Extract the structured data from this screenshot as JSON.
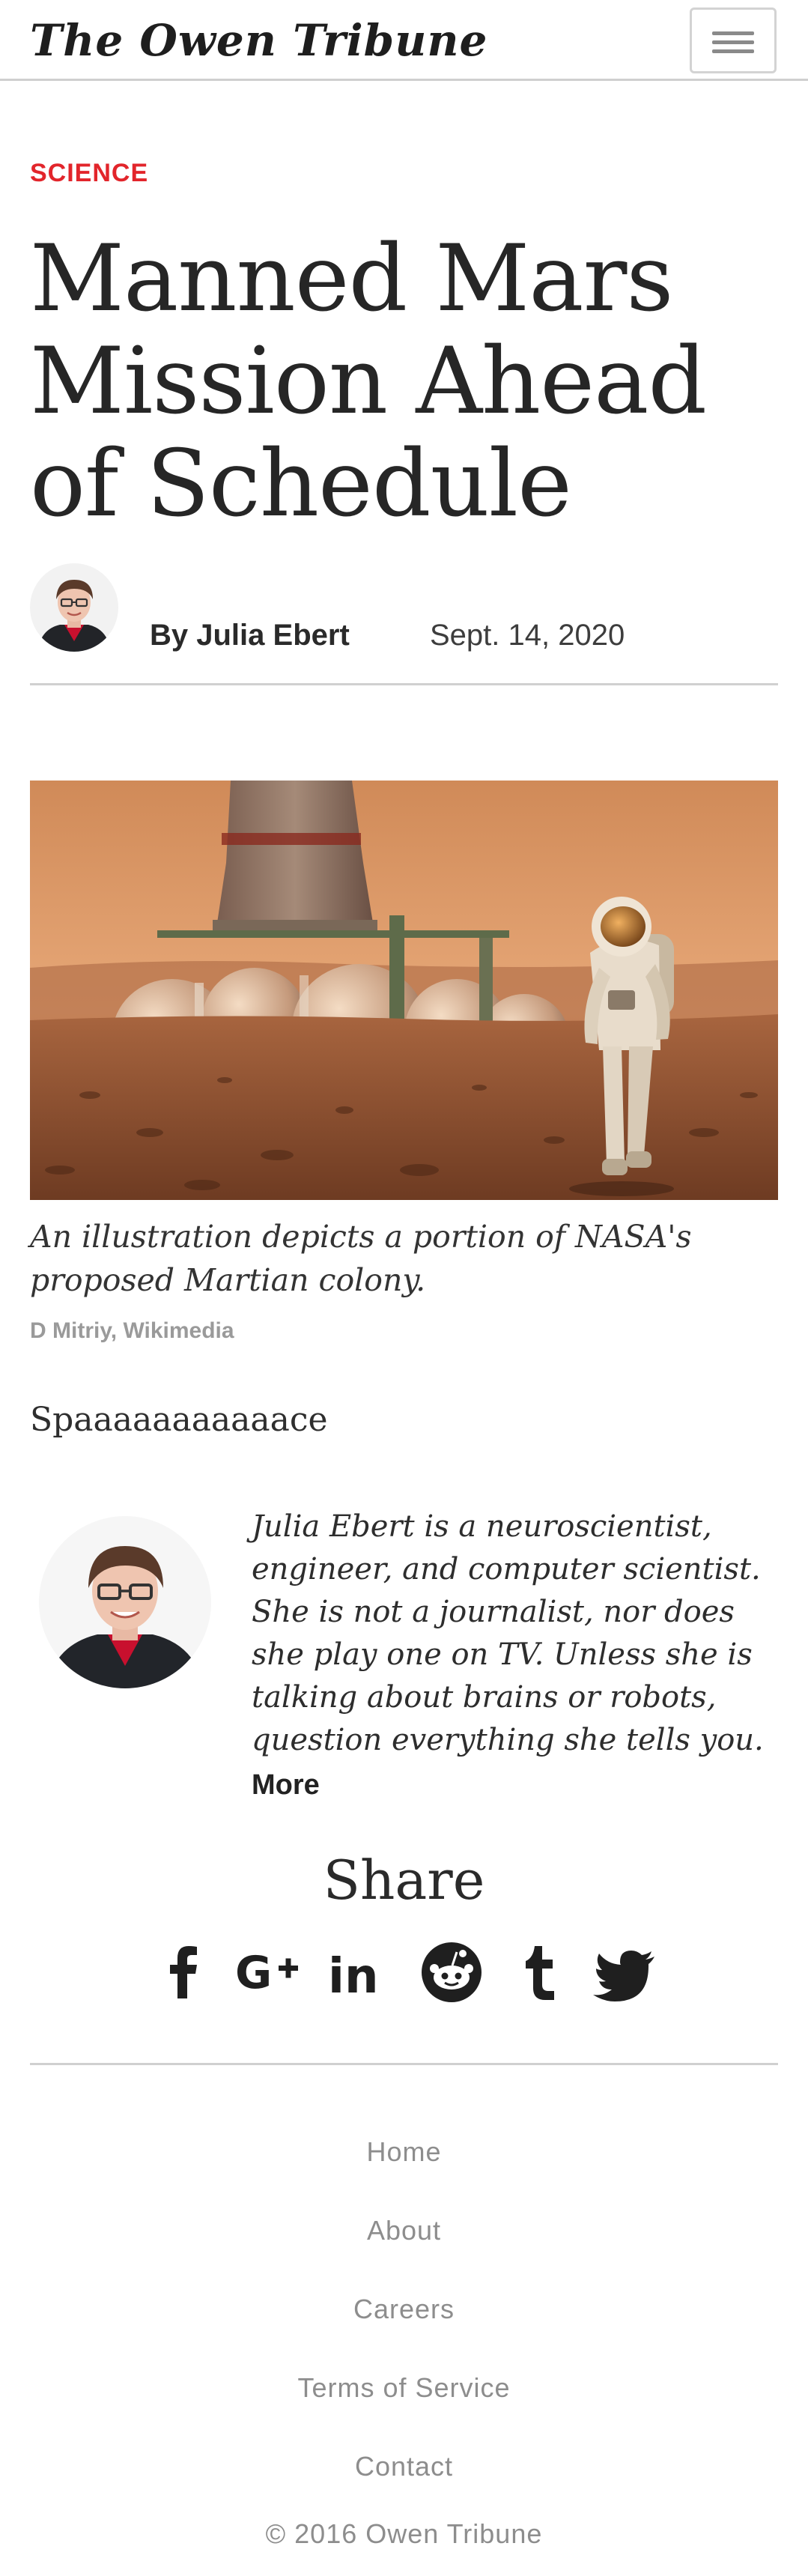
{
  "header": {
    "site_name": "The Owen Tribune",
    "menu_icon": "hamburger-menu-icon"
  },
  "article": {
    "section": "SCIENCE",
    "headline": "Manned Mars Mission Ahead of Schedule",
    "byline": "By Julia Ebert",
    "date": "Sept. 14, 2020",
    "image": {
      "caption": "An illustration depicts a portion of NASA's proposed Martian colony.",
      "credit": "D Mitriy, Wikimedia"
    },
    "body": "Spaaaaaaaaaaace"
  },
  "author_bio": {
    "text": "Julia Ebert is a neuroscientist, engineer, and computer scientist. She is not a journalist, nor does she play one on TV. Unless she is talking about brains or robots, question everything she tells you.",
    "more_label": "More"
  },
  "share": {
    "title": "Share",
    "icons": [
      "facebook-icon",
      "google-plus-icon",
      "linkedin-icon",
      "reddit-icon",
      "tumblr-icon",
      "twitter-icon"
    ]
  },
  "footer": {
    "links": [
      "Home",
      "About",
      "Careers",
      "Terms of Service",
      "Contact"
    ],
    "copyright": "© 2016 Owen Tribune"
  },
  "colors": {
    "accent": "#e2252b",
    "text": "#2b2b2b",
    "muted": "#8d8d8d"
  }
}
